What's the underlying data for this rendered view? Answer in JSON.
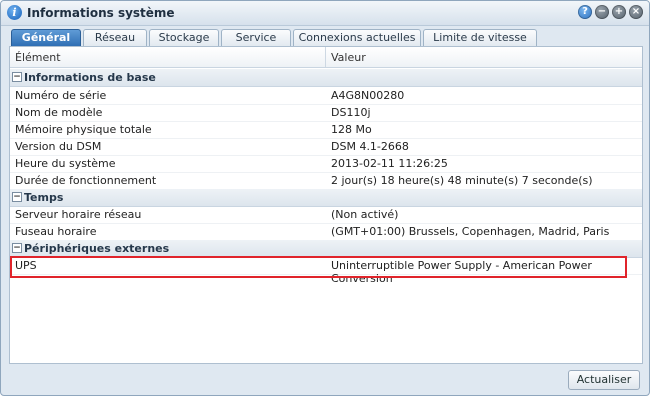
{
  "window": {
    "title": "Informations système",
    "buttons": [
      "help-icon",
      "minimize-icon",
      "maximize-icon",
      "close-icon"
    ]
  },
  "tabs": [
    {
      "label": "Général",
      "active": true
    },
    {
      "label": "Réseau",
      "active": false
    },
    {
      "label": "Stockage",
      "active": false
    },
    {
      "label": "Service",
      "active": false
    },
    {
      "label": "Connexions actuelles",
      "active": false
    },
    {
      "label": "Limite de vitesse",
      "active": false
    }
  ],
  "grid": {
    "headers": {
      "element": "Élément",
      "value": "Valeur"
    },
    "groups": [
      {
        "title": "Informations de base",
        "rows": [
          {
            "key": "Numéro de série",
            "value": "A4G8N00280"
          },
          {
            "key": "Nom de modèle",
            "value": "DS110j"
          },
          {
            "key": "Mémoire physique totale",
            "value": "128 Mo"
          },
          {
            "key": "Version du DSM",
            "value": "DSM 4.1-2668"
          },
          {
            "key": "Heure du système",
            "value": "2013-02-11 11:26:25"
          },
          {
            "key": "Durée de fonctionnement",
            "value": "2 jour(s) 18 heure(s) 48 minute(s) 7 seconde(s)"
          }
        ]
      },
      {
        "title": "Temps",
        "rows": [
          {
            "key": "Serveur horaire réseau",
            "value": "(Non activé)"
          },
          {
            "key": "Fuseau horaire",
            "value": "(GMT+01:00) Brussels, Copenhagen, Madrid, Paris"
          }
        ]
      },
      {
        "title": "Périphériques externes",
        "rows": [
          {
            "key": "UPS",
            "value": "Uninterruptible Power Supply - American Power Conversion"
          }
        ]
      }
    ]
  },
  "footer": {
    "refresh_label": "Actualiser"
  },
  "colors": {
    "active_tab": "#2f6fb4",
    "highlight": "#e0242b"
  }
}
